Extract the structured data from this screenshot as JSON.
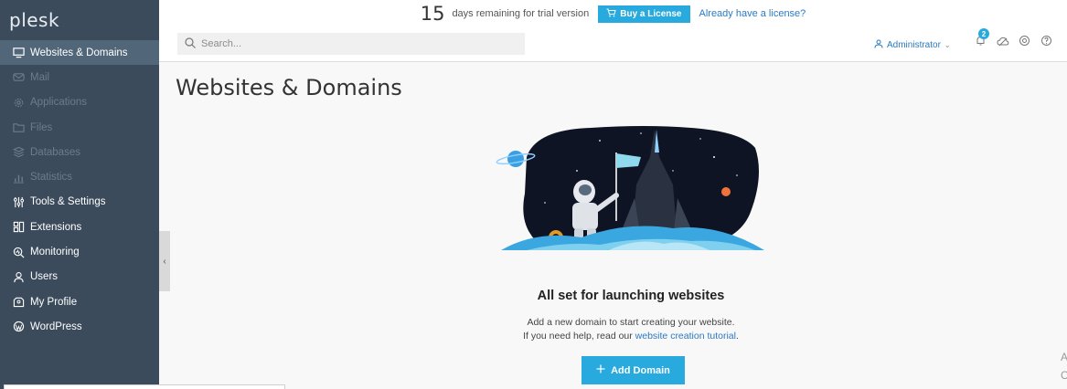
{
  "app": {
    "logo": "plesk"
  },
  "trial": {
    "days": "15",
    "days_text": "days remaining for trial version",
    "buy_label": "Buy a License",
    "already_label": "Already have a license?"
  },
  "search": {
    "placeholder": "Search..."
  },
  "user": {
    "name": "Administrator",
    "notifications": "2"
  },
  "sidebar": {
    "items": [
      {
        "label": "Websites & Domains",
        "icon": "monitor-icon",
        "state": "active"
      },
      {
        "label": "Mail",
        "icon": "mail-icon",
        "state": "disabled"
      },
      {
        "label": "Applications",
        "icon": "gear-icon",
        "state": "disabled"
      },
      {
        "label": "Files",
        "icon": "folder-icon",
        "state": "disabled"
      },
      {
        "label": "Databases",
        "icon": "database-icon",
        "state": "disabled"
      },
      {
        "label": "Statistics",
        "icon": "bar-chart-icon",
        "state": "disabled"
      },
      {
        "label": "Tools & Settings",
        "icon": "tools-icon",
        "state": "normal"
      },
      {
        "label": "Extensions",
        "icon": "puzzle-icon",
        "state": "normal"
      },
      {
        "label": "Monitoring",
        "icon": "monitoring-icon",
        "state": "normal"
      },
      {
        "label": "Users",
        "icon": "user-icon",
        "state": "normal"
      },
      {
        "label": "My Profile",
        "icon": "profile-icon",
        "state": "normal"
      },
      {
        "label": "WordPress",
        "icon": "wordpress-icon",
        "state": "normal"
      }
    ]
  },
  "main": {
    "title": "Websites & Domains",
    "empty_title": "All set for launching websites",
    "empty_line1": "Add a new domain to start creating your website.",
    "empty_line2_prefix": "If you need help, read our",
    "empty_link": "website creation tutorial",
    "empty_line2_suffix": ".",
    "add_domain_label": "Add Domain"
  },
  "edge": {
    "top": "A",
    "bottom": "C"
  },
  "colors": {
    "accent": "#28aade",
    "sidebar": "#3b4b5c",
    "link": "#2a7ac0"
  }
}
